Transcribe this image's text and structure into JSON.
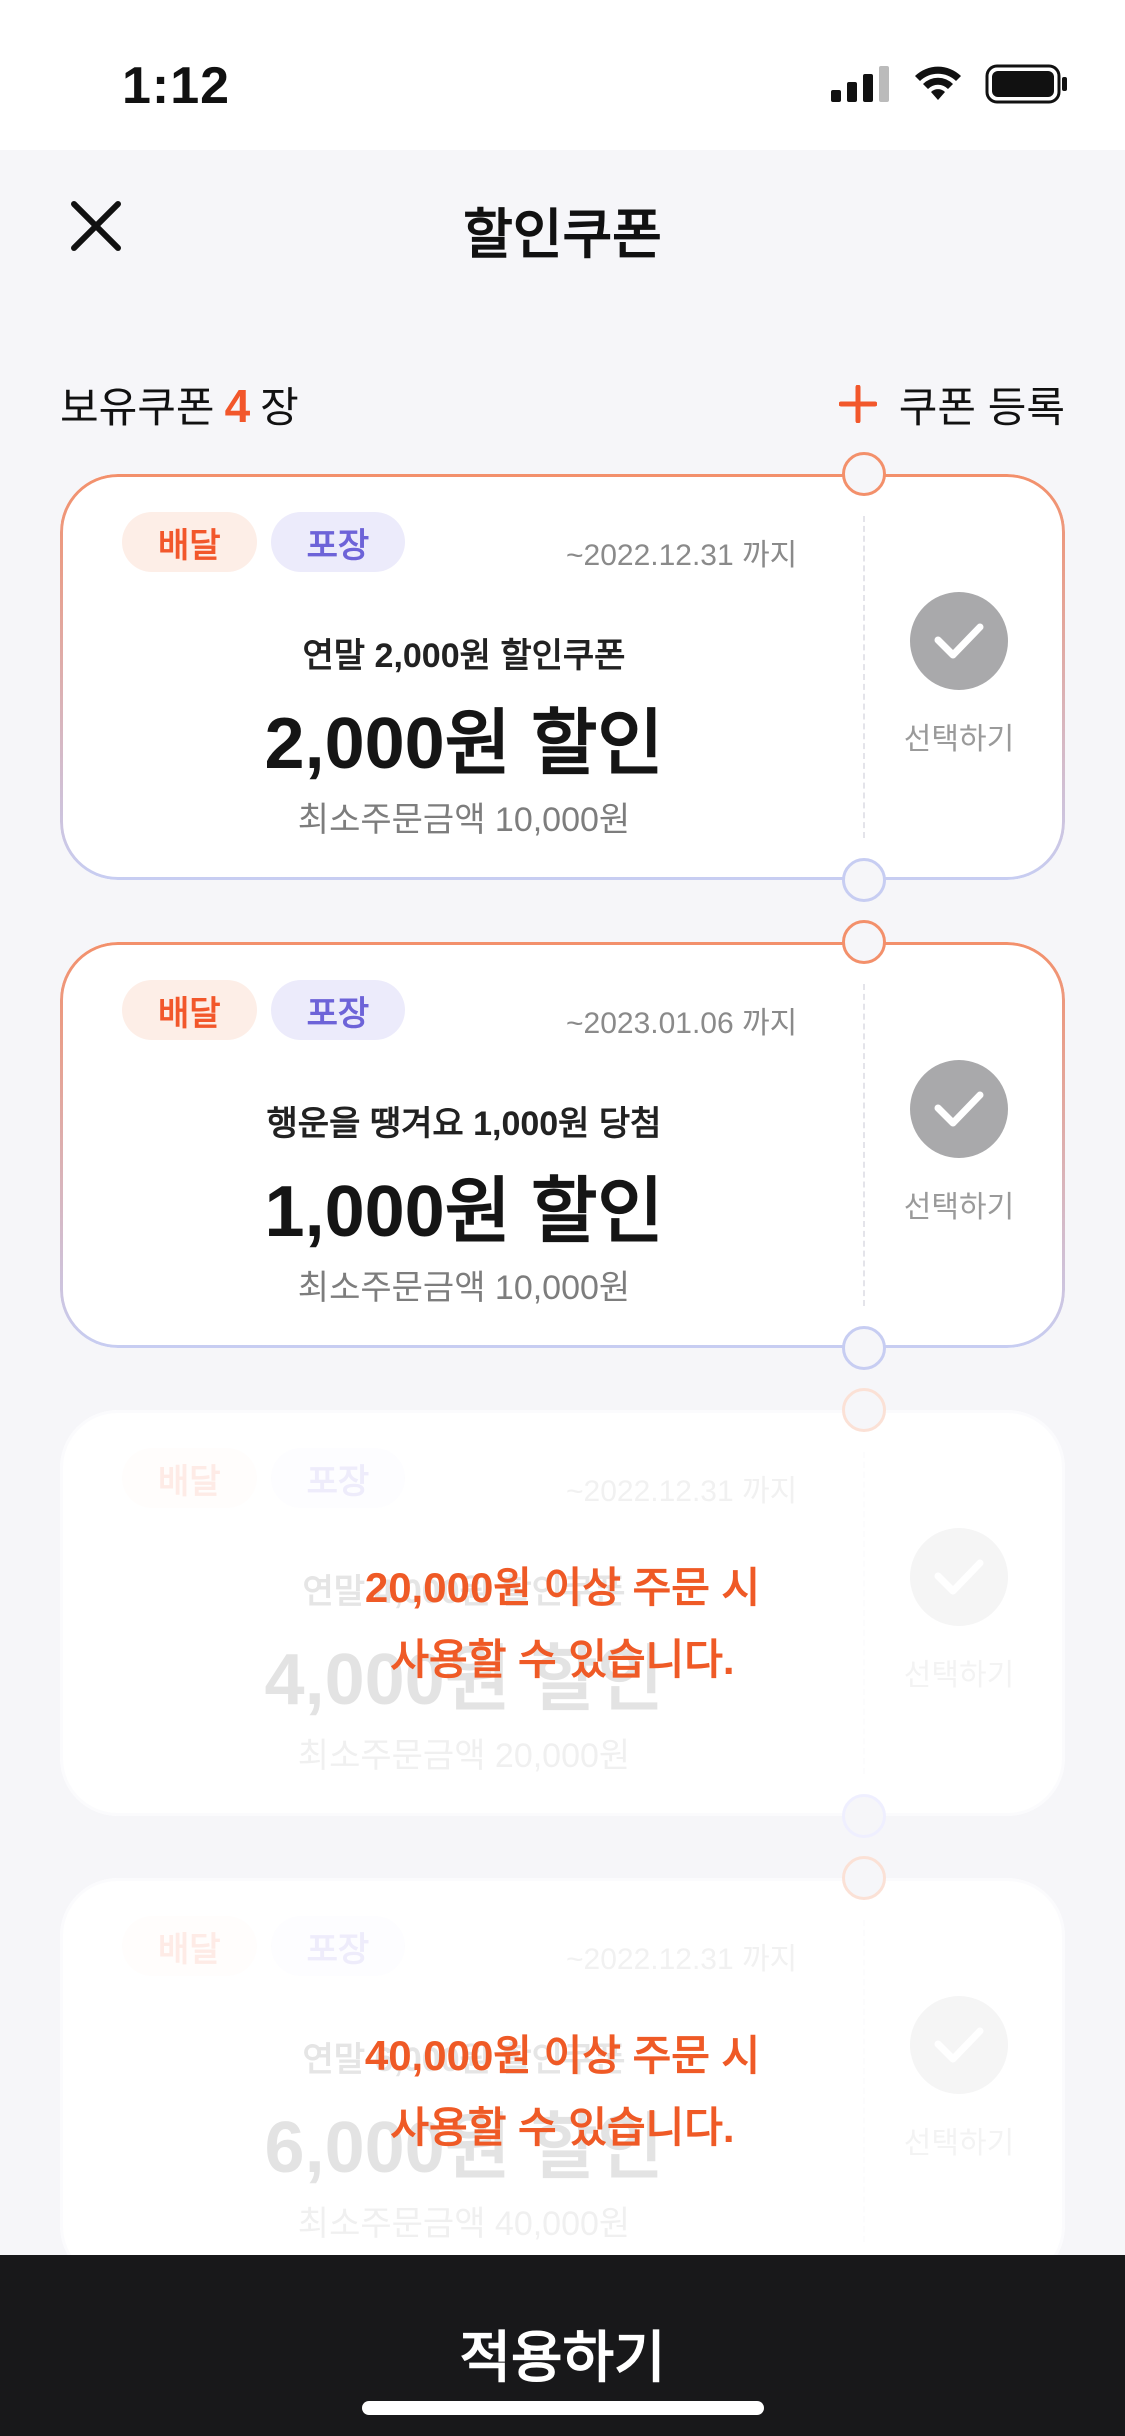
{
  "status": {
    "time": "1:12"
  },
  "header": {
    "title": "할인쿠폰"
  },
  "summary": {
    "prefix": "보유쿠폰",
    "count": "4",
    "suffix": "장",
    "register_label": "쿠폰 등록"
  },
  "coupons": [
    {
      "tag_delivery": "배달",
      "tag_takeout": "포장",
      "expire": "~2022.12.31 까지",
      "name": "연말 2,000원 할인쿠폰",
      "amount": "2,000원 할인",
      "min_order": "최소주문금액 10,000원",
      "select_label": "선택하기",
      "disabled_msg_1": "",
      "disabled_msg_2": ""
    },
    {
      "tag_delivery": "배달",
      "tag_takeout": "포장",
      "expire": "~2023.01.06 까지",
      "name": "행운을 땡겨요 1,000원 당첨",
      "amount": "1,000원 할인",
      "min_order": "최소주문금액 10,000원",
      "select_label": "선택하기",
      "disabled_msg_1": "",
      "disabled_msg_2": ""
    },
    {
      "tag_delivery": "배달",
      "tag_takeout": "포장",
      "expire": "~2022.12.31 까지",
      "name": "연말 4,000원 할인쿠폰",
      "amount": "4,000원 할인",
      "min_order": "최소주문금액 20,000원",
      "select_label": "선택하기",
      "disabled_msg_1": "20,000원 이상 주문 시",
      "disabled_msg_2": "사용할 수 있습니다."
    },
    {
      "tag_delivery": "배달",
      "tag_takeout": "포장",
      "expire": "~2022.12.31 까지",
      "name": "연말 6,000원 할인쿠폰",
      "amount": "6,000원 할인",
      "min_order": "최소주문금액 40,000원",
      "select_label": "선택하기",
      "disabled_msg_1": "40,000원 이상 주문 시",
      "disabled_msg_2": "사용할 수 있습니다."
    }
  ],
  "footer": {
    "apply_label": "적용하기"
  },
  "colors": {
    "accent": "#f2572b",
    "takeout": "#6d63d8",
    "apply_bar": "#18181a",
    "background": "#f6f6f9"
  }
}
